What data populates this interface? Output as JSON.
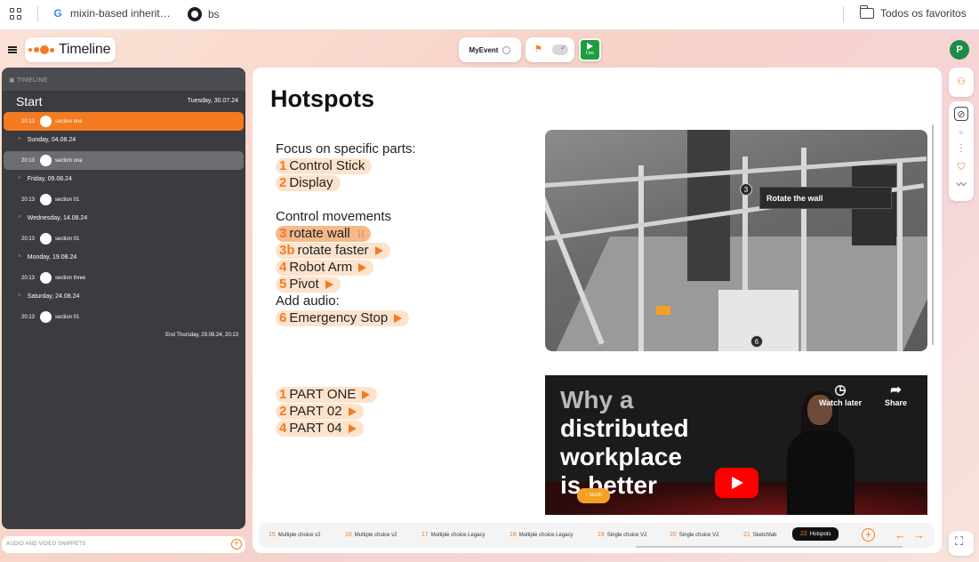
{
  "browser": {
    "bookmarks": [
      {
        "label": "mixin-based inherit…",
        "icon": "google-icon"
      },
      {
        "label": "bs",
        "icon": "github-icon"
      }
    ],
    "all_bookmarks": "Todos os favoritos"
  },
  "header": {
    "app_title": "Timeline",
    "event_name": "MyEvent",
    "live_label": "Live",
    "avatar_initial": "P"
  },
  "sidebar": {
    "heading": "TIMELINE",
    "start_label": "Start",
    "start_date": "Tuesday, 30.07.24",
    "rows": [
      {
        "type": "entry",
        "time": "20:13",
        "label": "section one",
        "state": "active"
      },
      {
        "type": "day",
        "label": "Sunday, 04.08.24"
      },
      {
        "type": "entry",
        "time": "20:13",
        "label": "section one",
        "state": "selected"
      },
      {
        "type": "day",
        "label": "Friday, 09.08.24"
      },
      {
        "type": "entry",
        "time": "20:13",
        "label": "section 01"
      },
      {
        "type": "day",
        "label": "Wednesday, 14.08.24"
      },
      {
        "type": "entry",
        "time": "20:13",
        "label": "section 01"
      },
      {
        "type": "day",
        "label": "Monday, 19.08.24"
      },
      {
        "type": "entry",
        "time": "20:13",
        "label": "section three"
      },
      {
        "type": "day",
        "label": "Saturday, 24.08.24"
      },
      {
        "type": "entry",
        "time": "20:13",
        "label": "section 01"
      }
    ],
    "end_label": "End Thursday, 29.08.24, 20:13",
    "audio_label": "AUDIO AND VIDEO SNIPPETS"
  },
  "main": {
    "title": "Hotspots",
    "intro_1": "Focus on specific parts:",
    "focus_items": [
      {
        "num": "1",
        "label": "Control Stick"
      },
      {
        "num": "2",
        "label": "Display"
      }
    ],
    "intro_2": "Control movements",
    "movement_items": [
      {
        "num": "3",
        "label": "rotate wall"
      },
      {
        "num": "3b",
        "label": "rotate faster"
      },
      {
        "num": "4",
        "label": "Robot Arm"
      },
      {
        "num": "5",
        "label": "Pivot"
      }
    ],
    "intro_3": "Add audio:",
    "audio_items": [
      {
        "num": "6",
        "label": "Emergency Stop"
      }
    ],
    "part_items": [
      {
        "num": "1",
        "label": "PART ONE"
      },
      {
        "num": "2",
        "label": " PART 02"
      },
      {
        "num": "4",
        "label": "PART 04"
      }
    ],
    "scene_tooltip": "Rotate the wall",
    "scene_markers": [
      "3",
      "6"
    ],
    "video": {
      "line1": "Why a",
      "line2": "distributed",
      "line3": "workplace",
      "line4": "is better",
      "watch_later": "Watch later",
      "share": "Share"
    },
    "scroll_badge": "scroll"
  },
  "slides": [
    {
      "num": "15",
      "label": "Multiple choice v2"
    },
    {
      "num": "16",
      "label": "Multiple choice v2"
    },
    {
      "num": "17",
      "label": "Multiple choice Legacy"
    },
    {
      "num": "18",
      "label": "Multiple choice Legacy"
    },
    {
      "num": "19",
      "label": "Single choice V2"
    },
    {
      "num": "20",
      "label": "Single choice V2"
    },
    {
      "num": "21",
      "label": "Sketchfab"
    },
    {
      "num": "22",
      "label": "Hotspots",
      "active": true
    }
  ],
  "colors": {
    "accent": "#f47b20",
    "live": "#1e9e3e",
    "sidebar": "#3a3c40"
  }
}
